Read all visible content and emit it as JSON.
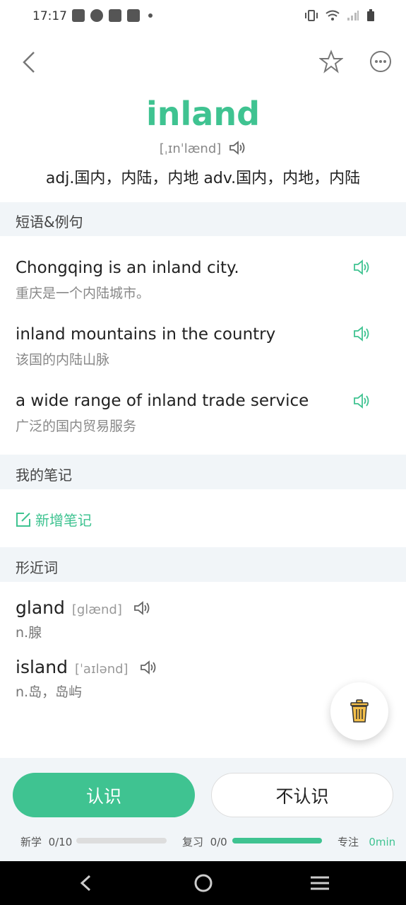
{
  "status_bar": {
    "time": "17:17"
  },
  "header": {
    "word": "inland",
    "phonetic": "[ˌɪnˈlænd]",
    "definition": "adj.国内，内陆，内地 adv.国内，内地，内陆"
  },
  "sections": {
    "phrases_title": "短语&例句",
    "notes_title": "我的笔记",
    "similar_title": "形近词"
  },
  "examples": [
    {
      "en": "Chongqing is an inland city.",
      "zh": "重庆是一个内陆城市。"
    },
    {
      "en": "inland mountains in the country",
      "zh": "该国的内陆山脉"
    },
    {
      "en": "a wide range of inland trade service",
      "zh": "广泛的国内贸易服务"
    }
  ],
  "notes": {
    "add_label": "新增笔记"
  },
  "similar_words": [
    {
      "word": "gland",
      "phonetic": "[glænd]",
      "meaning": "n.腺"
    },
    {
      "word": "island",
      "phonetic": "[ˈaɪlənd]",
      "meaning": "n.岛，岛屿"
    }
  ],
  "actions": {
    "know": "认识",
    "unknown": "不认识"
  },
  "progress": {
    "new_label": "新学",
    "new_value": "0/10",
    "new_fraction": 0,
    "review_label": "复习",
    "review_value": "0/0",
    "review_fraction": 1,
    "focus_label": "专注",
    "focus_value": "0min"
  },
  "colors": {
    "accent": "#3fc391",
    "section_bg": "#f1f5f8"
  },
  "icons": [
    "back-icon",
    "star-icon",
    "more-icon",
    "speaker-icon",
    "edit-icon",
    "trash-icon"
  ]
}
